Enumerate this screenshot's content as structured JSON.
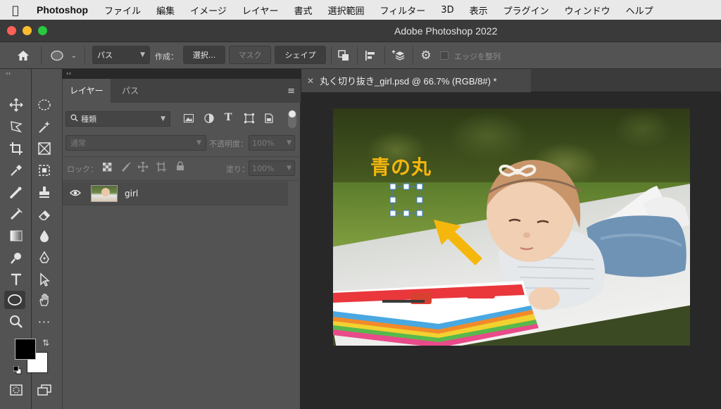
{
  "menubar": {
    "app_name": "Photoshop",
    "items": [
      "ファイル",
      "編集",
      "イメージ",
      "レイヤー",
      "書式",
      "選択範囲",
      "フィルター",
      "3D",
      "表示",
      "プラグイン",
      "ウィンドウ",
      "ヘルプ"
    ]
  },
  "window": {
    "title": "Adobe Photoshop 2022"
  },
  "options_bar": {
    "mode_value": "パス",
    "make_label": "作成：",
    "selection_button": "選択...",
    "mask_button": "マスク",
    "shape_button": "シェイプ",
    "align_edges_label": "エッジを整列"
  },
  "layers_panel": {
    "tabs": [
      "レイヤー",
      "パス"
    ],
    "filter_value": "種類",
    "blend_mode": "通常",
    "opacity_label": "不透明度：",
    "opacity_value": "100%",
    "lock_label": "ロック：",
    "fill_label": "塗り：",
    "fill_value": "100%",
    "layers": [
      {
        "name": "girl",
        "visible": true
      }
    ]
  },
  "document": {
    "tab_title": "丸く切り抜き_girl.psd @ 66.7% (RGB/8#) *",
    "close_label": "✕",
    "overlay_text": "青の丸"
  },
  "colors": {
    "accent_orange": "#f5b70c",
    "selection_blue": "#3a7bd5",
    "foreground": "#000000",
    "background": "#ffffff"
  }
}
